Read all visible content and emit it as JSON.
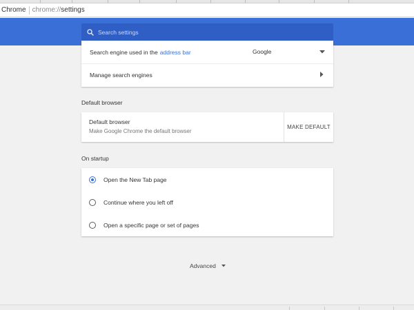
{
  "browser": {
    "site_label": "Chrome",
    "url_scheme": "chrome://",
    "url_path": "settings"
  },
  "header": {
    "search_placeholder": "Search settings",
    "accent_color": "#3b6fd8"
  },
  "search_engine_card": {
    "row1_label": "Search engine used in the",
    "row1_link": "address bar",
    "row1_value": "Google",
    "row2_label": "Manage search engines"
  },
  "default_browser": {
    "section_title": "Default browser",
    "primary": "Default browser",
    "secondary": "Make Google Chrome the default browser",
    "button": "MAKE DEFAULT"
  },
  "on_startup": {
    "section_title": "On startup",
    "options": [
      {
        "label": "Open the New Tab page",
        "checked": true
      },
      {
        "label": "Continue where you left off",
        "checked": false
      },
      {
        "label": "Open a specific page or set of pages",
        "checked": false
      }
    ]
  },
  "advanced": {
    "label": "Advanced"
  },
  "icons": {
    "search": "search-icon",
    "dropdown": "chevron-down-icon",
    "row_arrow": "chevron-right-icon",
    "advanced": "caret-down-icon"
  }
}
